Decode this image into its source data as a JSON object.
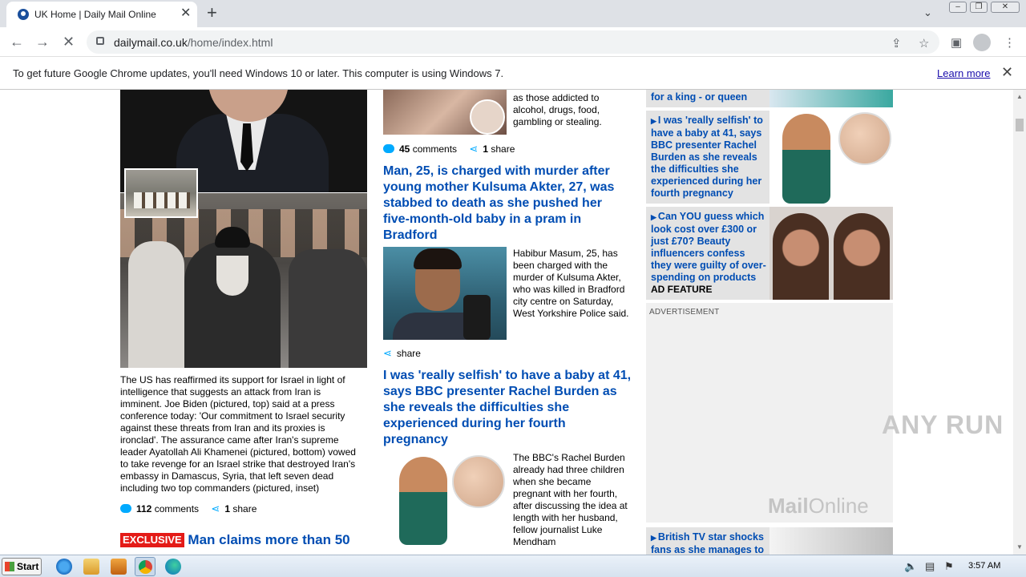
{
  "browser": {
    "tab_title": "UK Home | Daily Mail Online",
    "tab_close": "✕",
    "new_tab": "+",
    "url_domain": "dailymail.co.uk",
    "url_path": "/home/index.html"
  },
  "infobar": {
    "message": "To get future Google Chrome updates, you'll need Windows 10 or later. This computer is using Windows 7.",
    "learn_more": "Learn more"
  },
  "col1": {
    "caption": "The US has reaffirmed its support for Israel in light of intelligence that suggests an attack from Iran is imminent. Joe Biden (pictured, top) said at a press conference today: 'Our commitment to Israel security against these threats from Iran and its proxies is ironclad'. The assurance came after Iran's supreme leader Ayatollah Ali Khamenei (pictured, bottom) vowed to take revenge for an Israel strike that destroyed Iran's embassy in Damascus, Syria, that left seven dead including two top commanders (pictured, inset)",
    "comments_count": "112",
    "comments_label": "comments",
    "share_count": "1",
    "share_label": "share",
    "exclusive_badge": "EXCLUSIVE",
    "exclusive_headline": "Man claims more than 50"
  },
  "col2": {
    "story1_text": "as those addicted to alcohol, drugs, food, gambling or stealing.",
    "story1_comments": "45",
    "story1_comments_label": "comments",
    "story1_share_count": "1",
    "story1_share_label": "share",
    "story2_headline": "Man, 25, is charged with murder after young mother Kulsuma Akter, 27, was stabbed to death as she pushed her five-month-old baby in a pram in Bradford",
    "story2_text": "Habibur Masum, 25, has been charged with the murder of Kulsuma Akter, who was killed in Bradford city centre on Saturday, West Yorkshire Police said.",
    "story2_share_label": "share",
    "story3_headline": "I was 'really selfish' to have a baby at 41, says BBC presenter Rachel Burden as she reveals the difficulties she experienced during her fourth pregnancy",
    "story3_text": "The BBC's Rachel Burden already had three children when she became pregnant with her fourth, after discussing the idea at length with her husband, fellow journalist Luke Mendham"
  },
  "col3": {
    "card0_text": "for a king - or queen",
    "card1_text": "I was 'really selfish' to have a baby at 41, says BBC presenter Rachel Burden as she reveals the difficulties she experienced during her fourth pregnancy",
    "card2_text": "Can YOU guess which look cost over £300 or just £70? Beauty influencers confess they were guilty of over-spending on products",
    "card2_ad": "AD FEATURE",
    "ad_label": "ADVERTISEMENT",
    "watermark_mail": "Mail",
    "watermark_online": "Online",
    "card3_text": "British TV star shocks fans as she manages to"
  },
  "overlay": {
    "anyrun": "ANY RUN"
  },
  "taskbar": {
    "start": "Start",
    "time": "3:57 AM"
  }
}
